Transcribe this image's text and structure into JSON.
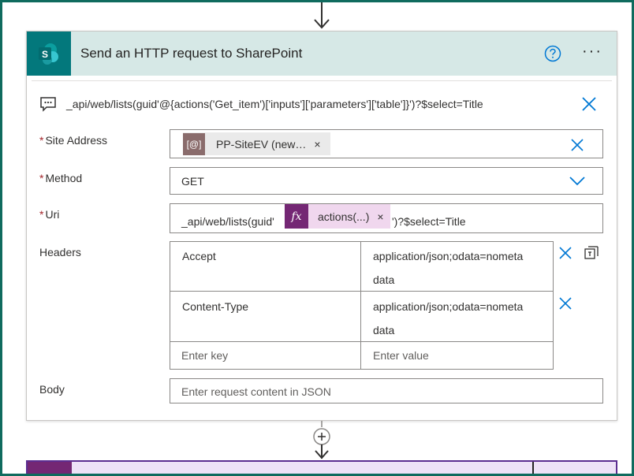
{
  "action": {
    "title": "Send an HTTP request to SharePoint",
    "icons": {
      "connector": "sharepoint-logo",
      "help": "help-circle-icon",
      "more": "more-options-icon"
    }
  },
  "summary": {
    "api_text": "_api/web/lists(guid'@{actions('Get_item')['inputs']['parameters']['table']}')?$select=Title"
  },
  "site_address": {
    "label": "Site Address",
    "required": "*",
    "token_icon": "[@]",
    "token_text": "PP-SiteEV (new…",
    "token_close": "×"
  },
  "method": {
    "label": "Method",
    "required": "*",
    "value": "GET"
  },
  "uri": {
    "label": "Uri",
    "required": "*",
    "prefix": "_api/web/lists(guid'",
    "expr_icon": "fx",
    "expr_text": "actions(...)",
    "expr_close": "×",
    "suffix": "')?$select=Title"
  },
  "headers": {
    "label": "Headers",
    "rows": [
      {
        "key": "Accept",
        "value_line1": "application/json;odata=nometa",
        "value_line2": "data"
      },
      {
        "key": "Content-Type",
        "value_line1": "application/json;odata=nometa",
        "value_line2": "data"
      }
    ],
    "key_placeholder": "Enter key",
    "value_placeholder": "Enter value"
  },
  "body": {
    "label": "Body",
    "placeholder": "Enter request content in JSON"
  },
  "colors": {
    "header_bg": "#d6e8e6",
    "sharepoint_teal": "#03787c",
    "accent_blue": "#0078d4",
    "required_red": "#a4262c",
    "expression_purple": "#742774",
    "dynamic_token_brown": "#8a6c6c",
    "frame_green": "#0f6b5e"
  }
}
